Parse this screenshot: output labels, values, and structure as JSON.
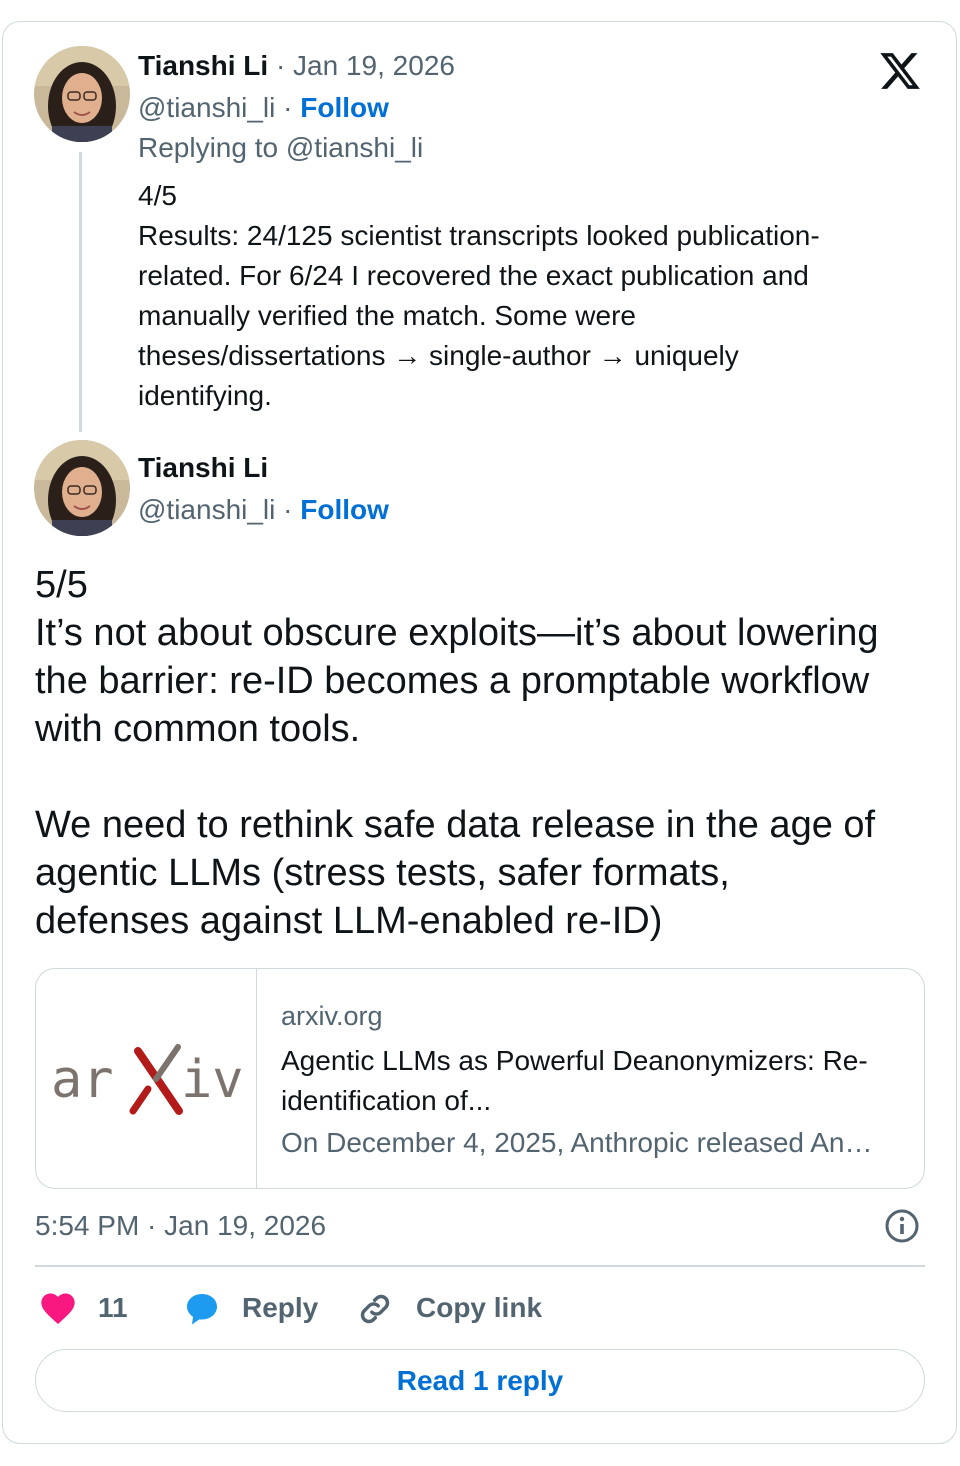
{
  "colors": {
    "follow": "#006fd6",
    "heart": "#f91880",
    "reply_bubble": "#1d9bf0",
    "muted": "#536471",
    "border": "#cfd9de"
  },
  "parent_tweet": {
    "author_name": "Tianshi Li",
    "date": "· Jan 19, 2026",
    "handle": "@tianshi_li",
    "dot": "·",
    "follow_label": "Follow",
    "replying_to": "Replying to @tianshi_li",
    "lines": [
      "4/5",
      "Results: 24/125 scientist transcripts looked publication-",
      "related. For 6/24 I recovered the exact publication and",
      "manually verified the match. Some were",
      "theses/dissertations → single-author → uniquely",
      "identifying."
    ]
  },
  "main_tweet": {
    "author_name": "Tianshi Li",
    "handle": "@tianshi_li",
    "dot": "·",
    "follow_label": "Follow",
    "lines": [
      "5/5",
      "It’s not about obscure exploits—it’s about lowering",
      "the barrier: re-ID becomes a promptable workflow",
      "with common tools.",
      "We need to rethink safe data release in the age of",
      "agentic LLMs (stress tests, safer formats,",
      "defenses against LLM-enabled re-ID)"
    ],
    "link_card": {
      "domain": "arxiv.org",
      "title_line1": "Agentic LLMs as Powerful Deanonymizers: Re-",
      "title_line2": "identification of...",
      "description": "On December 4, 2025, Anthropic released An…",
      "logo_text_left": "ar",
      "logo_text_right": "iv"
    },
    "timestamp": "5:54 PM · Jan 19, 2026",
    "like_count": "11",
    "reply_label": "Reply",
    "copy_link_label": "Copy link",
    "read_replies_label": "Read 1 reply"
  },
  "icons": {
    "brand": "x-logo-icon",
    "info": "info-icon",
    "like": "heart-icon",
    "reply": "reply-bubble-icon",
    "copy": "link-icon"
  }
}
